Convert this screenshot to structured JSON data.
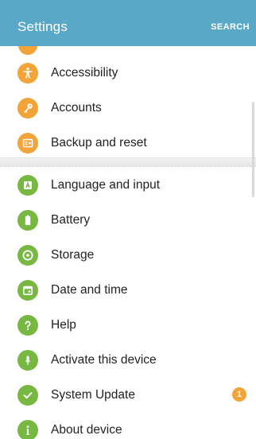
{
  "header": {
    "title": "Settings",
    "search_label": "SEARCH"
  },
  "colors": {
    "appbar": "#5aa8c8",
    "orange_icon": "#f2a438",
    "green_icon": "#77b843"
  },
  "settings_list": {
    "items": [
      {
        "label": "Accessibility",
        "icon": "accessibility-icon"
      },
      {
        "label": "Accounts",
        "icon": "key-icon"
      },
      {
        "label": "Backup and reset",
        "icon": "backup-icon"
      },
      {
        "label": "Language and input",
        "icon": "language-icon"
      },
      {
        "label": "Battery",
        "icon": "battery-icon"
      },
      {
        "label": "Storage",
        "icon": "storage-icon"
      },
      {
        "label": "Date and time",
        "icon": "calendar-icon"
      },
      {
        "label": "Help",
        "icon": "help-icon"
      },
      {
        "label": "Activate this device",
        "icon": "activate-icon"
      },
      {
        "label": "System Update",
        "icon": "system-update-icon",
        "badge": "1"
      },
      {
        "label": "About device",
        "icon": "info-icon"
      }
    ]
  }
}
